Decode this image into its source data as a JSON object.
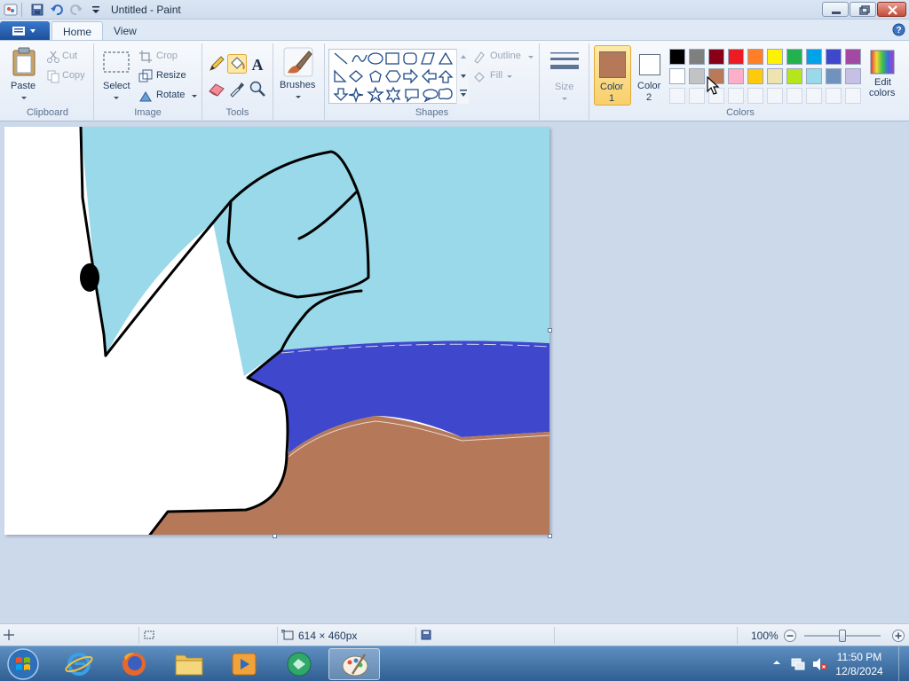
{
  "window": {
    "title": "Untitled - Paint"
  },
  "tabs": {
    "home": "Home",
    "view": "View"
  },
  "clipboard": {
    "paste": "Paste",
    "cut": "Cut",
    "copy": "Copy",
    "group": "Clipboard"
  },
  "image": {
    "select": "Select",
    "crop": "Crop",
    "resize": "Resize",
    "rotate": "Rotate",
    "group": "Image"
  },
  "tools": {
    "group": "Tools",
    "text_glyph": "A"
  },
  "brushes": {
    "label": "Brushes"
  },
  "shapes": {
    "group": "Shapes",
    "outline": "Outline",
    "fill": "Fill"
  },
  "size": {
    "label": "Size"
  },
  "colors": {
    "group": "Colors",
    "color1": {
      "line1": "Color",
      "line2": "1",
      "value": "#b5795a"
    },
    "color2": {
      "line1": "Color",
      "line2": "2",
      "value": "#ffffff"
    },
    "edit_line1": "Edit",
    "edit_line2": "colors",
    "row1": [
      "#000000",
      "#7f7f7f",
      "#880015",
      "#ed1c24",
      "#ff7f27",
      "#fff200",
      "#22b14c",
      "#00a2e8",
      "#3f48cc",
      "#a349a4"
    ],
    "row2": [
      "#ffffff",
      "#c3c3c3",
      "#b97a57",
      "#ffaec9",
      "#ffc90e",
      "#efe4b0",
      "#b5e61d",
      "#99d9ea",
      "#7092be",
      "#c8bfe7"
    ]
  },
  "canvas_colors": {
    "sky": "#99d9ea",
    "water": "#3f48cc",
    "sand": "#b5795a",
    "ink": "#000000"
  },
  "status": {
    "dimensions": "614 × 460px",
    "zoom": "100%",
    "zoom_level": 1.0
  },
  "taskbar": {
    "time": "11:50 PM",
    "date": "12/8/2024"
  }
}
